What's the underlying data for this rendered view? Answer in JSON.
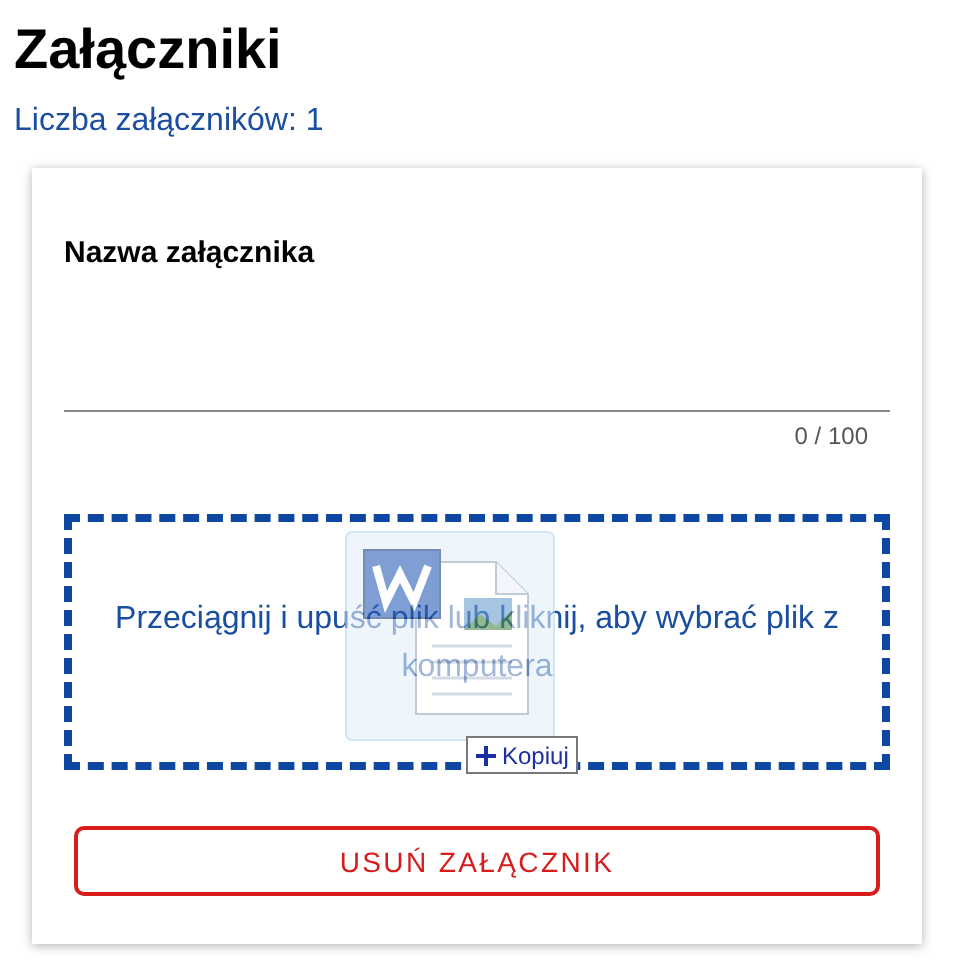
{
  "title": "Załączniki",
  "count_label": "Liczba załączników: 1",
  "card": {
    "field": {
      "label": "Nazwa załącznika",
      "counter": "0 / 100"
    },
    "dropzone": {
      "text": "Przeciągnij i upuść plik lub kliknij, aby wybrać plik z komputera",
      "dragging": true,
      "drag_badge": "Kopiuj"
    },
    "remove_button": "USUŃ ZAŁĄCZNIK"
  }
}
